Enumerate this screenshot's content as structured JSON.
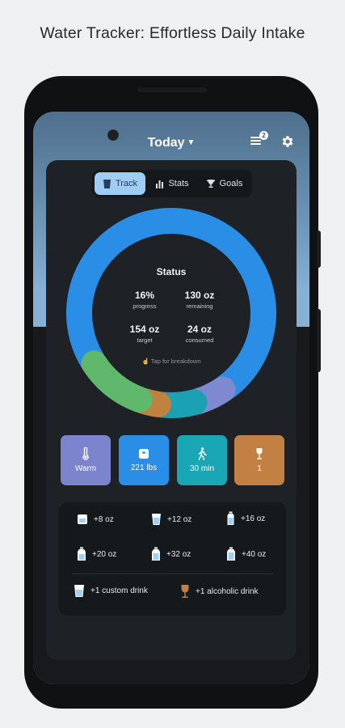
{
  "caption": "Water Tracker: Effortless Daily Intake",
  "header": {
    "title": "Today",
    "notification_count": "2"
  },
  "tabs": [
    {
      "label": "Track",
      "active": true
    },
    {
      "label": "Stats",
      "active": false
    },
    {
      "label": "Goals",
      "active": false
    }
  ],
  "status": {
    "title": "Status",
    "progress_value": "16%",
    "progress_label": "progress",
    "remaining_value": "130 oz",
    "remaining_label": "remaining",
    "target_value": "154 oz",
    "target_label": "target",
    "consumed_value": "24 oz",
    "consumed_label": "consumed",
    "tap_hint": "Tap for breakdown"
  },
  "ring_segments": [
    {
      "name": "base",
      "value": 89,
      "color": "#2b8ee6"
    },
    {
      "name": "weather",
      "value": 6.5,
      "color": "#7e89cf"
    },
    {
      "name": "activity",
      "value": 7.5,
      "color": "#1aa1b3"
    },
    {
      "name": "alcohol",
      "value": 4,
      "color": "#c0803e"
    },
    {
      "name": "other",
      "value": 13,
      "color": "#5fb86b"
    }
  ],
  "conditions": [
    {
      "label": "Warm",
      "icon": "thermometer-icon",
      "color": "#7b84cc"
    },
    {
      "label": "221 lbs",
      "icon": "scale-icon",
      "color": "#2b8ee6"
    },
    {
      "label": "30 min",
      "icon": "walking-icon",
      "color": "#19a6b5"
    },
    {
      "label": "1",
      "icon": "wine-glass-icon",
      "color": "#c28042"
    }
  ],
  "drinks": [
    {
      "label": "+8 oz",
      "icon": "small-cup-icon"
    },
    {
      "label": "+12 oz",
      "icon": "glass-icon"
    },
    {
      "label": "+16 oz",
      "icon": "bottle-icon"
    },
    {
      "label": "+20 oz",
      "icon": "bottle-icon"
    },
    {
      "label": "+32 oz",
      "icon": "bottle-icon"
    },
    {
      "label": "+40 oz",
      "icon": "bottle-icon"
    },
    {
      "label": "+1 custom drink",
      "icon": "custom-drink-icon"
    },
    {
      "label": "+1 alcoholic drink",
      "icon": "wine-glass-icon"
    }
  ],
  "colors": {
    "water_blue": "#9fd0f7",
    "alcohol_orange": "#c0803e",
    "card_bg": "#1e2227"
  }
}
